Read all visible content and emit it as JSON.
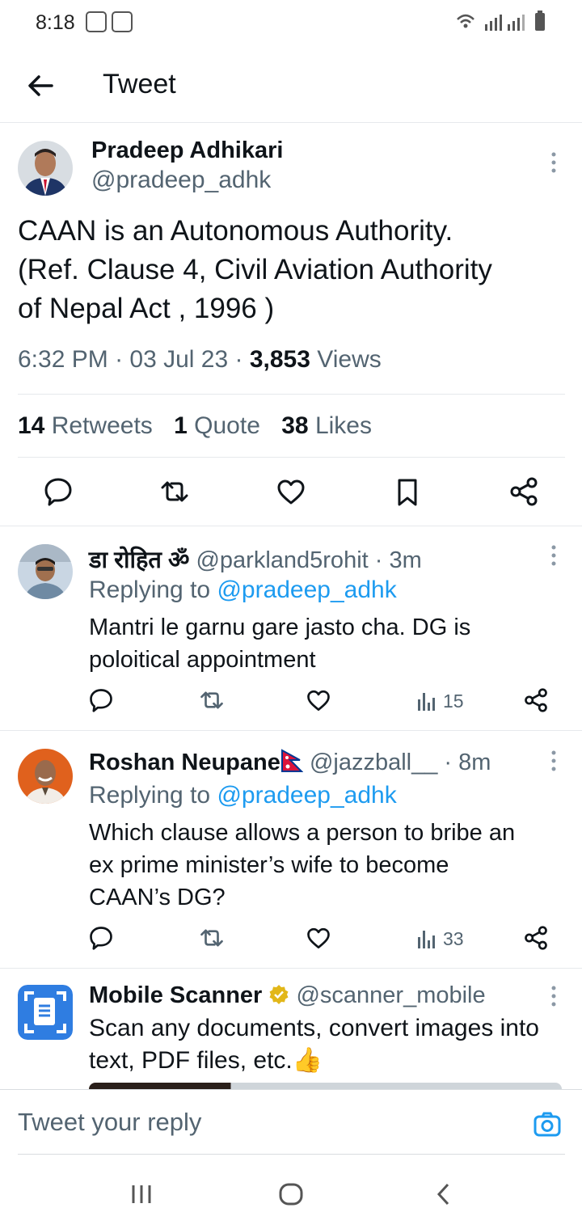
{
  "status_bar": {
    "time": "8:18"
  },
  "header": {
    "title": "Tweet"
  },
  "main_tweet": {
    "author_name": "Pradeep Adhikari",
    "author_handle": "@pradeep_adhk",
    "text_line1": "CAAN is an Autonomous Authority.",
    "text_line2": "(Ref. Clause 4, Civil Aviation Authority",
    "text_line3": "of Nepal Act , 1996 )",
    "time": "6:32 PM",
    "date": "03 Jul 23",
    "views_count": "3,853",
    "views_label": "Views",
    "retweets_count": "14",
    "retweets_label": "Retweets",
    "quotes_count": "1",
    "quotes_label": "Quote",
    "likes_count": "38",
    "likes_label": "Likes"
  },
  "replies": [
    {
      "name": "डा रोहित ॐ",
      "handle": "@parkland5rohit",
      "age": "3m",
      "replying_prefix": "Replying to",
      "replying_to": "@pradeep_adhk",
      "text_line1": "Mantri le garnu gare jasto cha. DG is",
      "text_line2": "poloitical appointment",
      "views": "15"
    },
    {
      "name": "Roshan Neupane",
      "handle": "@jazzball__",
      "age": "8m",
      "replying_prefix": "Replying to",
      "replying_to": "@pradeep_adhk",
      "text_line1": "Which clause allows a person to bribe an",
      "text_line2": "ex prime minister’s wife to become",
      "text_line3": "CAAN’s DG?",
      "views": "33"
    }
  ],
  "ad": {
    "name": "Mobile Scanner",
    "handle": "@scanner_mobile",
    "text_line1": "Scan any documents, convert images into",
    "text_line2": "text, PDF files, etc.",
    "emoji": "👍"
  },
  "reply_bar": {
    "placeholder": "Tweet your reply"
  },
  "colors": {
    "link": "#1d9bf0",
    "secondary": "#536471",
    "primary": "#0f1419"
  }
}
